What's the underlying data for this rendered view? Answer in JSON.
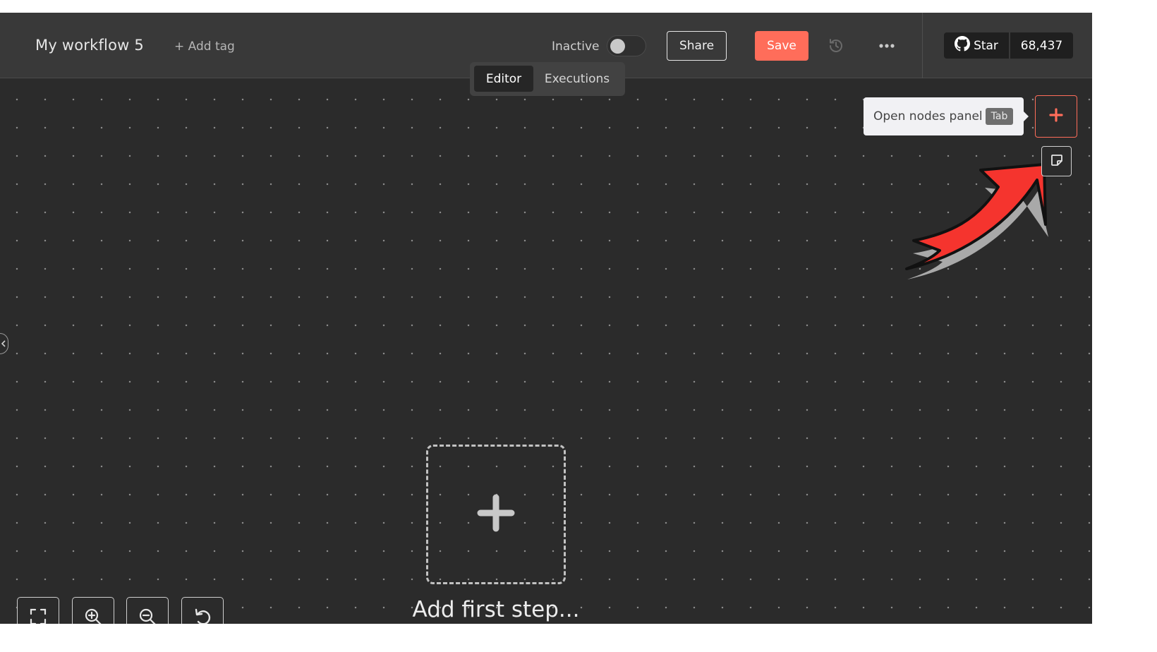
{
  "header": {
    "workflow_title": "My workflow 5",
    "add_tag_label": "+ Add tag",
    "active_toggle": {
      "label": "Inactive",
      "active": false
    },
    "share_label": "Share",
    "save_label": "Save",
    "github": {
      "star_label": "Star",
      "count": "68,437"
    }
  },
  "tabs": [
    {
      "label": "Editor",
      "selected": true
    },
    {
      "label": "Executions",
      "selected": false
    }
  ],
  "nodes_panel": {
    "tooltip_text": "Open nodes panel",
    "shortcut": "Tab"
  },
  "canvas": {
    "add_first_step_label": "Add first step..."
  },
  "icons": {
    "history": "history-icon",
    "more": "more-horizontal-icon",
    "github": "github-icon",
    "plus": "plus-icon",
    "sticky_note": "sticky-note-icon",
    "fit_view": "fit-view-icon",
    "zoom_in": "zoom-in-icon",
    "zoom_out": "zoom-out-icon",
    "reset_zoom": "undo-icon",
    "collapse_sidebar": "chevron-left-icon",
    "annotation_arrow": "arrow-annotation-icon"
  },
  "colors": {
    "accent": "#ff6d5a",
    "canvas_bg": "#2b2b2b",
    "header_bg": "#393939",
    "annotation_arrow": "#f5342e"
  }
}
